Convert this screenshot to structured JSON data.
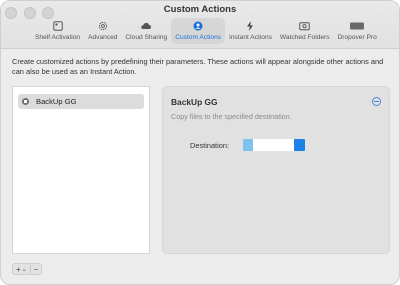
{
  "window": {
    "title": "Custom Actions"
  },
  "tabs": [
    {
      "label": "Shelf Activation",
      "icon": "shelf-icon"
    },
    {
      "label": "Advanced",
      "icon": "gear-icon"
    },
    {
      "label": "Cloud Sharing",
      "icon": "cloud-icon"
    },
    {
      "label": "Custom Actions",
      "icon": "person-icon",
      "active": true
    },
    {
      "label": "Instant Actions",
      "icon": "bolt-icon"
    },
    {
      "label": "Watched Folders",
      "icon": "photo-folder-icon"
    },
    {
      "label": "Dropover Pro",
      "icon": "pro-badge-icon",
      "badge": "PRO"
    }
  ],
  "description": "Create customized actions by predefining their parameters. These actions will appear alongside other actions and can also be used as an Instant Action.",
  "actions_list": {
    "items": [
      {
        "label": "BackUp GG",
        "selected": true
      }
    ]
  },
  "detail": {
    "title": "BackUp GG",
    "subtitle": "Copy files to the specified destination.",
    "destination_label": "Destination:"
  },
  "bottom_controls": {
    "add_label": "+",
    "dropdown_label": "⌄",
    "remove_label": "−"
  },
  "colors": {
    "accent": "#1c6fd6",
    "destination_left": "#7cc4ef",
    "destination_right": "#1d82e8"
  }
}
